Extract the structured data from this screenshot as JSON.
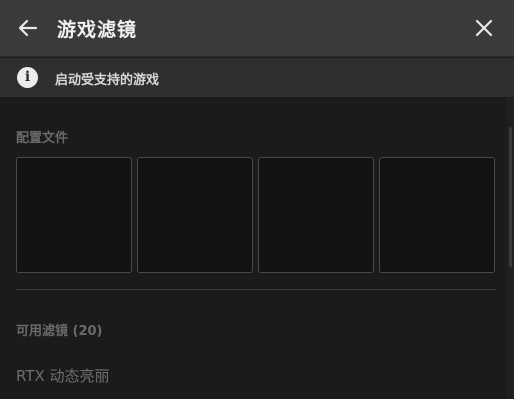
{
  "header": {
    "title": "游戏滤镜",
    "back_icon": "arrow-left-icon",
    "close_icon": "close-icon"
  },
  "info_bar": {
    "icon": "info-icon",
    "icon_glyph": "i",
    "text": "启动受支持的游戏"
  },
  "profiles": {
    "label": "配置文件",
    "slots": [
      "",
      "",
      "",
      ""
    ]
  },
  "filters": {
    "label": "可用滤镜 (20)",
    "items": [
      {
        "label": "RTX 动态亮丽"
      }
    ]
  },
  "colors": {
    "header_bg": "#3a3a3a",
    "info_bar_bg": "#2f2f2f",
    "content_bg": "#1b1b1b",
    "slot_bg": "#121212",
    "slot_border": "#4a4a4a"
  }
}
